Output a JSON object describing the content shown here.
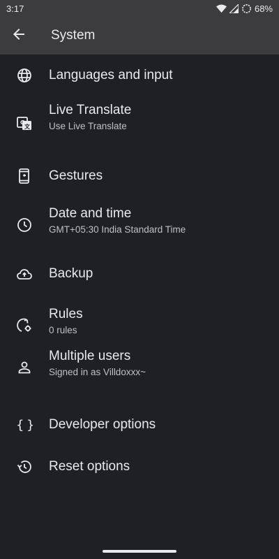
{
  "status_bar": {
    "time": "3:17",
    "battery": "68%"
  },
  "app_bar": {
    "title": "System"
  },
  "items": [
    {
      "title": "Languages and input",
      "subtitle": "",
      "icon": "globe-icon"
    },
    {
      "title": "Live Translate",
      "subtitle": "Use Live Translate",
      "icon": "translate-icon"
    },
    {
      "title": "Gestures",
      "subtitle": "",
      "icon": "gestures-phone-icon"
    },
    {
      "title": "Date and time",
      "subtitle": "GMT+05:30 India Standard Time",
      "icon": "clock-icon"
    },
    {
      "title": "Backup",
      "subtitle": "",
      "icon": "cloud-upload-icon"
    },
    {
      "title": "Rules",
      "subtitle": "0 rules",
      "icon": "rules-icon"
    },
    {
      "title": "Multiple users",
      "subtitle": "Signed in as Villdoxxx~",
      "icon": "person-icon"
    },
    {
      "title": "Developer options",
      "subtitle": "",
      "icon": "braces-icon"
    },
    {
      "title": "Reset options",
      "subtitle": "",
      "icon": "history-icon"
    }
  ],
  "colors": {
    "background": "#1f2023",
    "app_bar": "#3c3c3e",
    "text_primary": "#e8eaed",
    "text_secondary": "#bdc1c6"
  }
}
